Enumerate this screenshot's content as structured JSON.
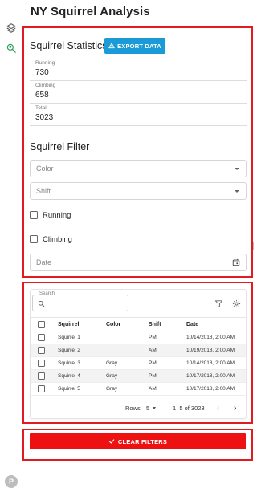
{
  "app": {
    "title": "NY Squirrel Analysis"
  },
  "rail": {
    "avatar_letter": "P"
  },
  "stats": {
    "title": "Squirrel Statistics",
    "export_label": "EXPORT DATA",
    "items": [
      {
        "label": "Running",
        "value": "730"
      },
      {
        "label": "Climbing",
        "value": "658"
      },
      {
        "label": "Total",
        "value": "3023"
      }
    ]
  },
  "filter": {
    "title": "Squirrel Filter",
    "color_placeholder": "Color",
    "shift_placeholder": "Shift",
    "running_label": "Running",
    "climbing_label": "Climbing",
    "date_placeholder": "Date"
  },
  "table": {
    "search_label": "Search",
    "columns": [
      "Squirrel",
      "Color",
      "Shift",
      "Date"
    ],
    "rows": [
      [
        "Squirrel 1",
        "",
        "PM",
        "10/14/2018, 2:00 AM"
      ],
      [
        "Squirrel 2",
        "",
        "AM",
        "10/19/2018, 2:00 AM"
      ],
      [
        "Squirrel 3",
        "Gray",
        "PM",
        "10/14/2018, 2:00 AM"
      ],
      [
        "Squirrel 4",
        "Gray",
        "PM",
        "10/17/2018, 2:00 AM"
      ],
      [
        "Squirrel 5",
        "Gray",
        "AM",
        "10/17/2018, 2:00 AM"
      ]
    ],
    "rows_label": "Rows",
    "rows_per_page": "5",
    "range_text": "1–5 of 3023"
  },
  "clear": {
    "label": "CLEAR FILTERS"
  },
  "colors": {
    "accent_blue": "#1a9bd7",
    "clear_red": "#ee1111",
    "highlight_red": "#e21b23"
  }
}
